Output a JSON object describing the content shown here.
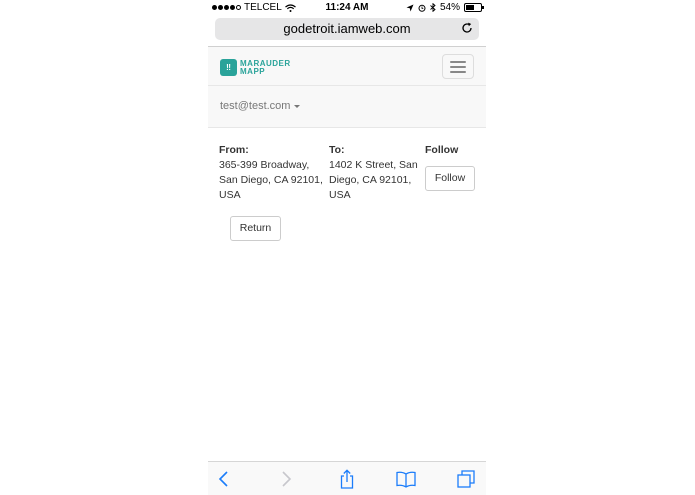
{
  "status_bar": {
    "carrier": "TELCEL",
    "time": "11:24 AM",
    "battery": "54%",
    "battery_level": 0.54
  },
  "browser": {
    "url": "godetroit.iamweb.com"
  },
  "navbar": {
    "brand_line1": "MARAUDER",
    "brand_line2": "MAPP",
    "user_email": "test@test.com"
  },
  "trip": {
    "from_label": "From:",
    "from_line1": "365-399 Broadway,",
    "from_line2": "San Diego, CA 92101,",
    "from_line3": "USA",
    "to_label": "To:",
    "to_line1": "1402 K Street, San",
    "to_line2": "Diego, CA 92101,",
    "to_line3": "USA",
    "follow_label": "Follow",
    "follow_button": "Follow",
    "return_button": "Return"
  },
  "icons": {
    "back": "chevron-left-icon",
    "forward": "chevron-right-icon",
    "share": "share-icon",
    "bookmarks": "book-icon",
    "tabs": "tabs-icon"
  },
  "colors": {
    "brand": "#2aa39a",
    "ios_blue": "#1b7dfa"
  }
}
